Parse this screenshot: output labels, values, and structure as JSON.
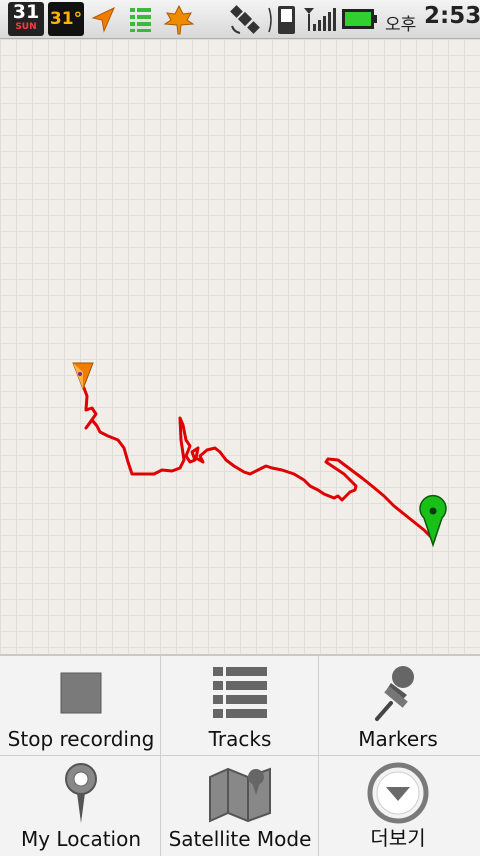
{
  "status_bar": {
    "calendar_day": "31",
    "calendar_weekday": "SUN",
    "temperature": "31°",
    "ampm": "오후",
    "time": "2:53",
    "icons": [
      "calendar-icon",
      "weather-icon",
      "navigation-arrow-icon",
      "list-icon",
      "maple-leaf-icon",
      "gps-satellite-icon",
      "phone-icon",
      "signal-icon",
      "battery-icon"
    ]
  },
  "map": {
    "track_color": "#e10000",
    "start_marker": "green-pin-icon",
    "current_position": "orange-arrow-icon"
  },
  "menu": {
    "items": [
      {
        "label": "Stop recording",
        "icon": "stop-icon"
      },
      {
        "label": "Tracks",
        "icon": "list-icon"
      },
      {
        "label": "Markers",
        "icon": "pushpin-icon"
      },
      {
        "label": "My Location",
        "icon": "location-pin-icon"
      },
      {
        "label": "Satellite Mode",
        "icon": "map-icon"
      },
      {
        "label": "더보기",
        "icon": "more-icon"
      }
    ]
  }
}
